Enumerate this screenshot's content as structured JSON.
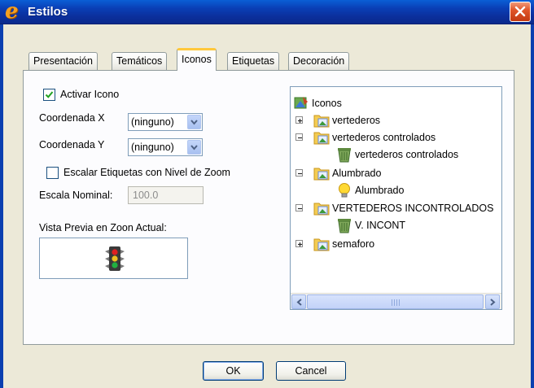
{
  "window": {
    "title": "Estilos",
    "app_icon_glyph": "e",
    "close_icon": "close-icon"
  },
  "tabs": [
    {
      "label": "Presentación",
      "active": false
    },
    {
      "label": "Temáticos",
      "active": false
    },
    {
      "label": "Iconos",
      "active": true
    },
    {
      "label": "Etiquetas",
      "active": false
    },
    {
      "label": "Decoración",
      "active": false
    }
  ],
  "iconos": {
    "activar_icono": {
      "label": "Activar Icono",
      "checked": true
    },
    "coord_x": {
      "label": "Coordenada X",
      "value": "(ninguno)"
    },
    "coord_y": {
      "label": "Coordenada Y",
      "value": "(ninguno)"
    },
    "escalar": {
      "label": "Escalar Etiquetas con Nivel de Zoom",
      "checked": false
    },
    "escala_nominal": {
      "label": "Escala Nominal:",
      "value": "100.0"
    },
    "vista_previa": {
      "label": "Vista Previa en Zoon Actual:",
      "icon": "traffic-light-icon"
    }
  },
  "tree": {
    "root": "Iconos",
    "items": [
      {
        "label": "vertederos",
        "expanded": false
      },
      {
        "label": "vertederos controlados",
        "expanded": true,
        "child": "vertederos controlados",
        "child_icon": "trash-can-icon"
      },
      {
        "label": "Alumbrado",
        "expanded": true,
        "child": "Alumbrado",
        "child_icon": "lightbulb-icon"
      },
      {
        "label": "VERTEDEROS INCONTROLADOS",
        "expanded": true,
        "child": "V. INCONT",
        "child_icon": "trash-can-icon"
      },
      {
        "label": "semaforo",
        "expanded": false
      }
    ]
  },
  "buttons": {
    "ok": "OK",
    "cancel": "Cancel"
  },
  "colors": {
    "titlebar": "#0a3fb6",
    "tab_highlight": "#ffc83c",
    "dialog_bg": "#ece9d8"
  }
}
